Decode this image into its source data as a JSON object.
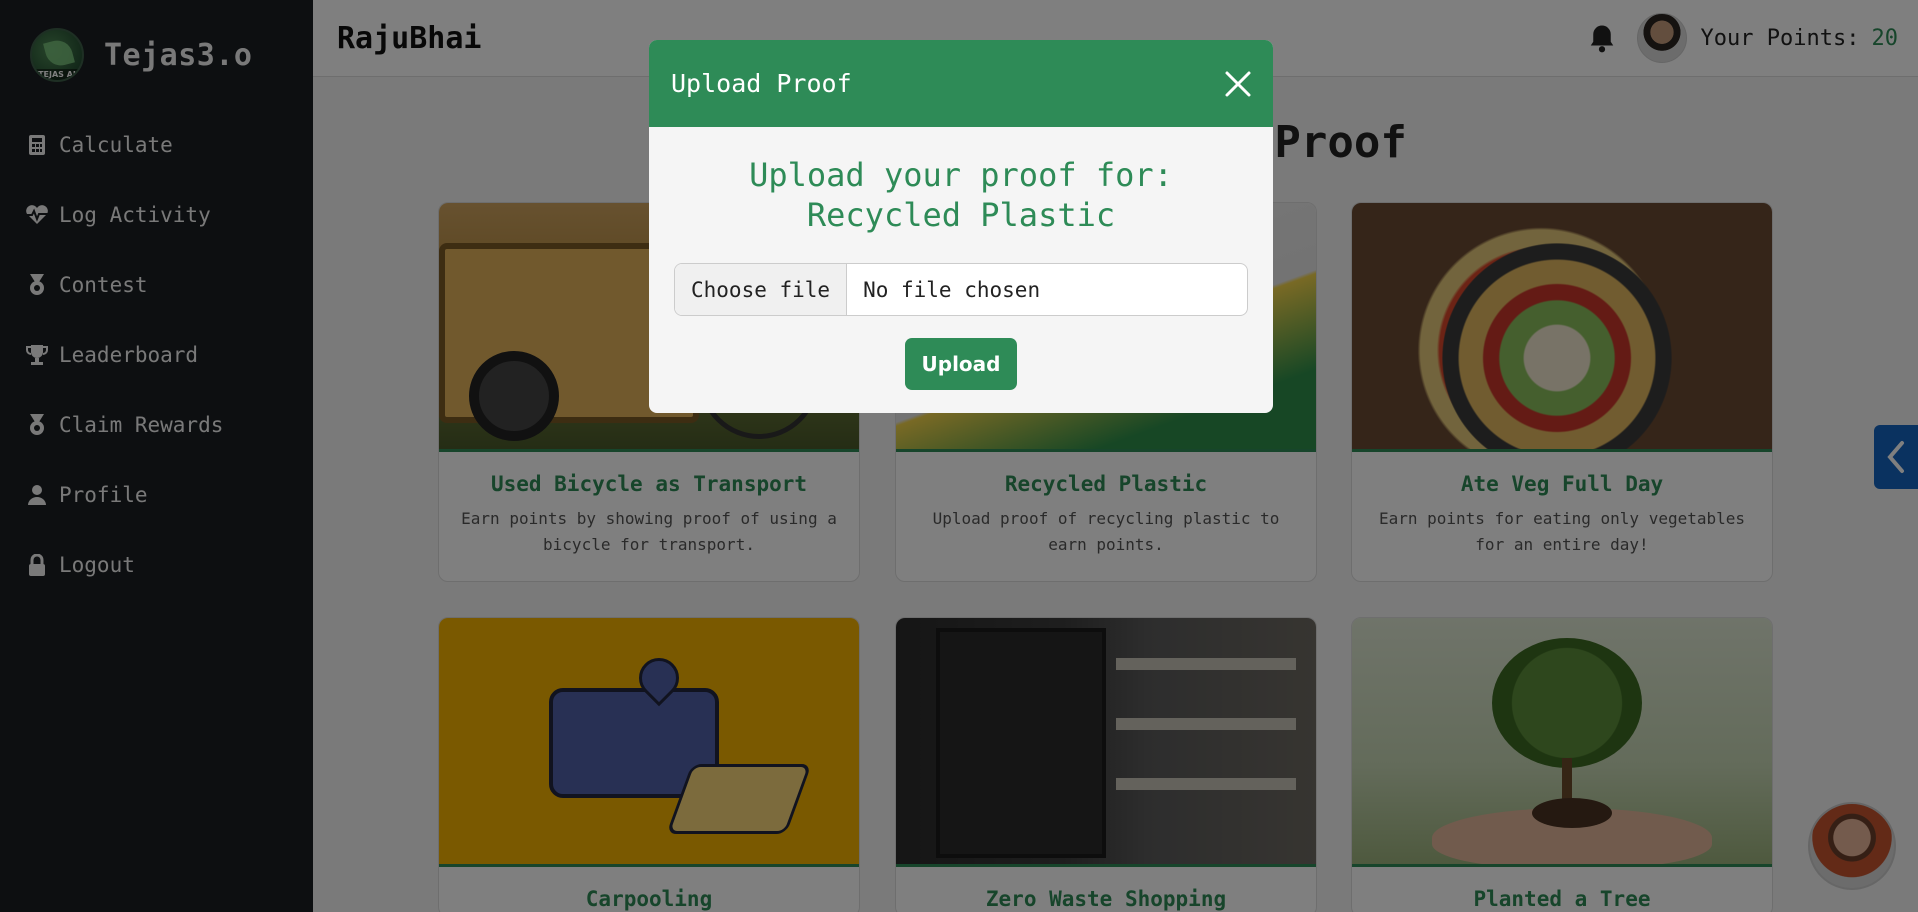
{
  "brand": {
    "logo_text": "TEJAS AI",
    "name": "Tejas3.o"
  },
  "sidebar": {
    "items": [
      {
        "label": "Calculate",
        "icon": "calculator-icon"
      },
      {
        "label": "Log Activity",
        "icon": "heartbeat-icon"
      },
      {
        "label": "Contest",
        "icon": "medal-icon"
      },
      {
        "label": "Leaderboard",
        "icon": "trophy-icon"
      },
      {
        "label": "Claim Rewards",
        "icon": "medal-icon"
      },
      {
        "label": "Profile",
        "icon": "user-icon"
      },
      {
        "label": "Logout",
        "icon": "lock-icon"
      }
    ]
  },
  "header": {
    "title": "RajuBhai",
    "points_label": "Your Points:",
    "points_value": "20"
  },
  "main": {
    "title": "Upload Recycling Proof",
    "cards": [
      {
        "title": "Used Bicycle as Transport",
        "desc": "Earn points by showing proof of using a bicycle for transport."
      },
      {
        "title": "Recycled Plastic",
        "desc": "Upload proof of recycling plastic to earn points."
      },
      {
        "title": "Ate Veg Full Day",
        "desc": "Earn points for eating only vegetables for an entire day!"
      },
      {
        "title": "Carpooling",
        "desc": ""
      },
      {
        "title": "Zero Waste Shopping",
        "desc": ""
      },
      {
        "title": "Planted a Tree",
        "desc": ""
      }
    ]
  },
  "modal": {
    "title": "Upload Proof",
    "heading_line1": "Upload your proof for:",
    "heading_line2": "Recycled Plastic",
    "file_button": "Choose file",
    "file_status": "No file chosen",
    "upload_label": "Upload"
  },
  "colors": {
    "accent": "#2e8b57",
    "sidebar_bg": "#1a1e22",
    "side_tab": "#1565c0"
  }
}
